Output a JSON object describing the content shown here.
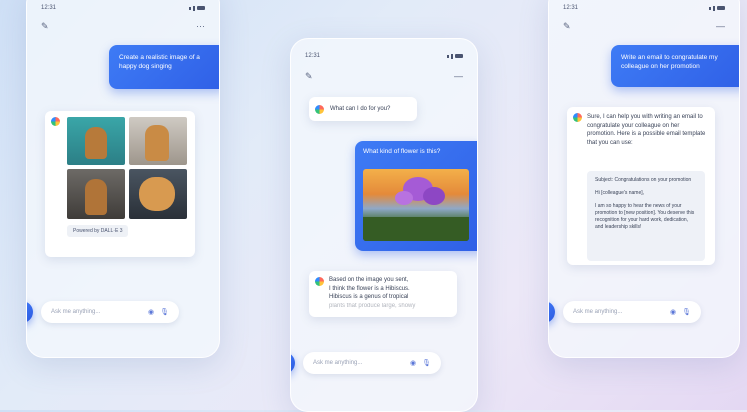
{
  "colors": {
    "accent": "#2f5fe6",
    "background": "#e2ebf8"
  },
  "phones": [
    {
      "time": "12:31",
      "user_message": "Create a realistic image of a happy dog singing",
      "image_caption": "Powered by DALL·E 3",
      "input_placeholder": "Ask me anything...",
      "compose_icon": "compose-icon",
      "menu_icon": "more-icon"
    },
    {
      "time": "12:31",
      "ai_greeting": "What can I do for you?",
      "user_message": "What kind of flower is this?",
      "ai_reply_line1": "Based on the image you sent,",
      "ai_reply_line2": "I think the flower is a Hibiscus.",
      "ai_reply_line3": "Hibiscus is a genus of tropical",
      "ai_reply_line4": "plants that produce large, showy",
      "input_placeholder": "Ask me anything..."
    },
    {
      "time": "12:31",
      "user_message": "Write an email to congratulate my colleague on her promotion",
      "ai_reply": "Sure, I can help you with writing an email to congratulate your colleague on her promotion. Here is a possible email template that you can use:",
      "email_subject": "Subject: Congratulations on your promotion",
      "email_greeting": "Hi [colleague's name],",
      "email_body": "I am so happy to hear the news of your promotion to [new position]. You deserve this recognition for your hard work, dedication, and leadership skills!",
      "input_placeholder": "Ask me anything..."
    }
  ]
}
